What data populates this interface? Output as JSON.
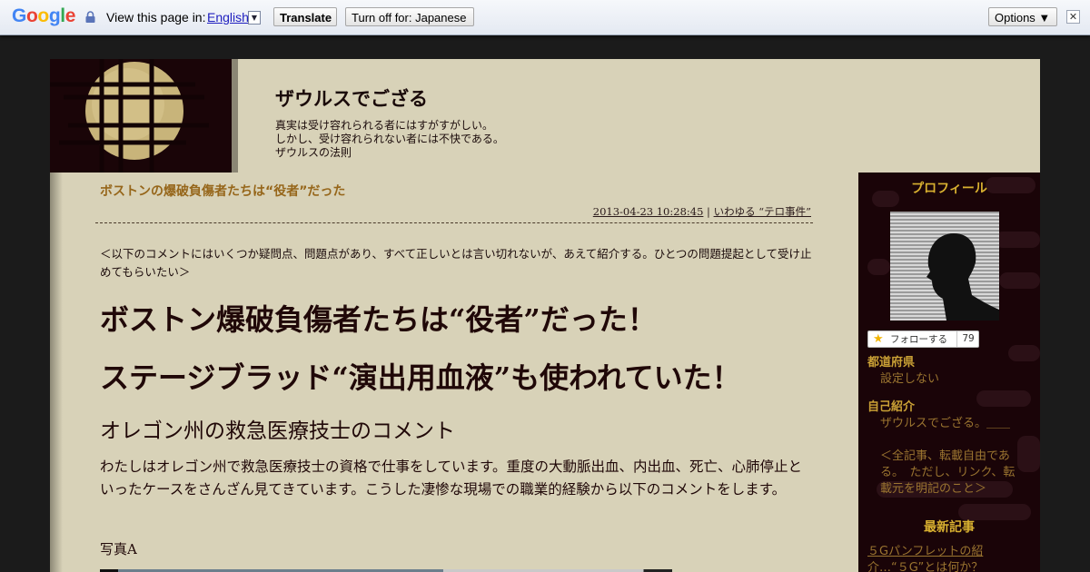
{
  "translate_bar": {
    "logo_letters": [
      "G",
      "o",
      "o",
      "g",
      "l",
      "e"
    ],
    "logo_colors": [
      "#4285f4",
      "#ea4335",
      "#fbbc05",
      "#4285f4",
      "#34a853",
      "#ea4335"
    ],
    "view_label": "View this page in:",
    "language": "English",
    "translate_button": "Translate",
    "turn_off_button": "Turn off for: Japanese",
    "options_button": "Options ▼",
    "close_glyph": "✕"
  },
  "header": {
    "site_title": "ザウルスでござる",
    "tagline": [
      "真実は受け容れられる者にはすがすがしい。",
      "しかし、受け容れられない者には不快である。",
      "ザウルスの法則"
    ]
  },
  "post": {
    "title": "ボストンの爆破負傷者たちは“役者”だった",
    "date": "2013-04-23 10:28:45",
    "separator": " | ",
    "category": "いわゆる “テロ事件”",
    "intro": "＜以下のコメントにはいくつか疑問点、問題点があり、すべて正しいとは言い切れないが、あえて紹介する。ひとつの問題提起として受け止めてもらいたい＞",
    "headline_1": "ボストン爆破負傷者たちは“役者”だった！",
    "headline_2": "ステージブラッド“演出用血液”も使われていた！",
    "subheading": "オレゴン州の救急医療技士のコメント",
    "body": "わたしはオレゴン州で救急医療技士の資格で仕事をしています。重度の大動脈出血、内出血、死亡、心肺停止といったケースをさんざん見てきています。こうした凄惨な現場での職業的経験から以下のコメントをします。",
    "caption": "写真A"
  },
  "sidebar": {
    "profile_heading": "プロフィール",
    "follow_label": "フォローする",
    "follow_count": "79",
    "prefecture_label": "都道府県",
    "prefecture_value": "設定しない",
    "intro_label": "自己紹介",
    "intro_value_1": "ザウルスでござる。＿＿",
    "intro_value_2": "＜全記事、転載自由である。　ただし、リンク、転載元を明記のこと＞",
    "recent_heading": "最新記事",
    "recent_link": "５Gパンフレットの紹介…“５G”とは何か？"
  }
}
